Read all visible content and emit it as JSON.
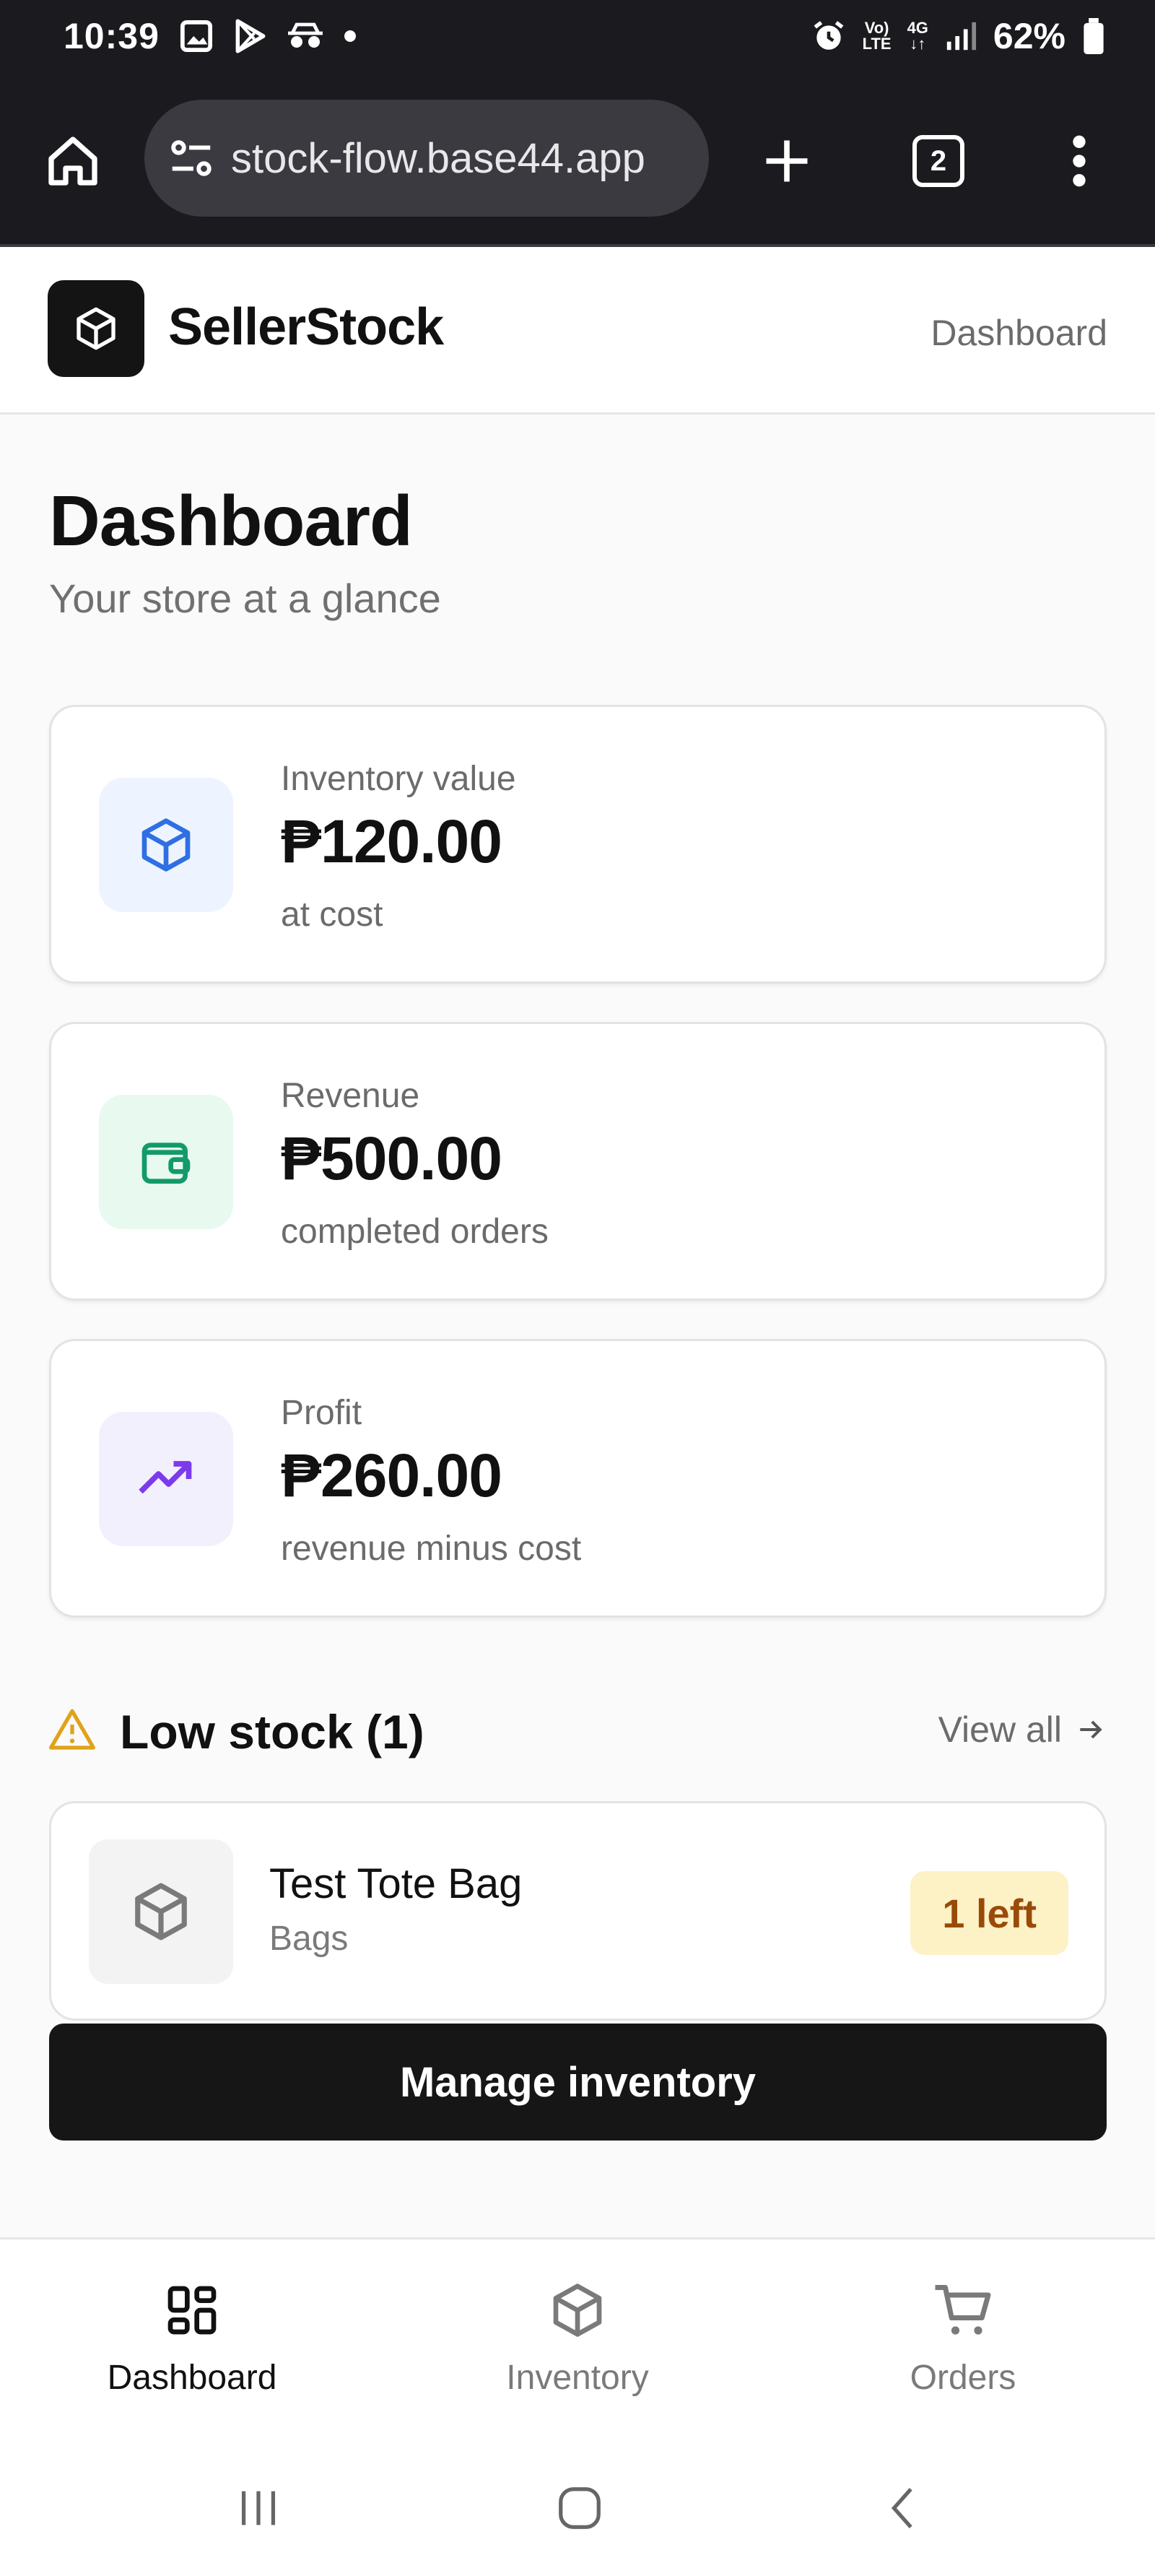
{
  "status_bar": {
    "time": "10:39",
    "network_top": "Vo)",
    "network_bottom": "LTE",
    "network_type": "4G",
    "battery": "62%"
  },
  "browser": {
    "url": "stock-flow.base44.app",
    "tab_count": "2"
  },
  "header": {
    "brand": "SellerStock",
    "nav_link": "Dashboard"
  },
  "page": {
    "title": "Dashboard",
    "subtitle": "Your store at a glance"
  },
  "stats": [
    {
      "label": "Inventory value",
      "value": "₱120.00",
      "note": "at cost",
      "icon": "box-icon",
      "icon_bg": "#eef4ff",
      "icon_color": "#2f6fe4"
    },
    {
      "label": "Revenue",
      "value": "₱500.00",
      "note": "completed orders",
      "icon": "wallet-icon",
      "icon_bg": "#e8f9f0",
      "icon_color": "#139a6a"
    },
    {
      "label": "Profit",
      "value": "₱260.00",
      "note": "revenue minus cost",
      "icon": "trending-up-icon",
      "icon_bg": "#f3f0fe",
      "icon_color": "#7c3aed"
    }
  ],
  "low_stock": {
    "title": "Low stock (1)",
    "view_all": "View all",
    "warning_color": "#e0a21a",
    "items": [
      {
        "name": "Test Tote Bag",
        "category": "Bags",
        "badge": "1 left"
      }
    ]
  },
  "actions": {
    "manage_inventory": "Manage inventory"
  },
  "bottom_nav": [
    {
      "label": "Dashboard",
      "icon": "grid-icon",
      "active": true
    },
    {
      "label": "Inventory",
      "icon": "box-icon",
      "active": false
    },
    {
      "label": "Orders",
      "icon": "cart-icon",
      "active": false
    }
  ]
}
